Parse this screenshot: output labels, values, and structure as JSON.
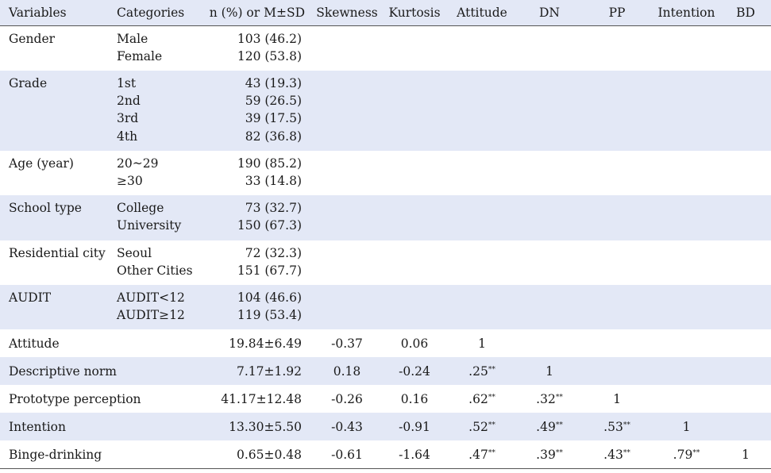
{
  "headers": [
    "Variables",
    "Categories",
    "n (%) or M±SD",
    "Skewness",
    "Kurtosis",
    "Attitude",
    "DN",
    "PP",
    "Intention",
    "BD"
  ],
  "groups": [
    {
      "name": "Gender",
      "categories": [
        "Male",
        "Female"
      ],
      "values": [
        "103 (46.2)",
        "120 (53.8)"
      ]
    },
    {
      "name": "Grade",
      "categories": [
        "1st",
        "2nd",
        "3rd",
        "4th"
      ],
      "values": [
        "43 (19.3)",
        "59 (26.5)",
        "39 (17.5)",
        "82 (36.8)"
      ]
    },
    {
      "name": "Age (year)",
      "categories": [
        "20~29",
        "≥30"
      ],
      "values": [
        "190 (85.2)",
        "33 (14.8)"
      ]
    },
    {
      "name": "School type",
      "categories": [
        "College",
        "University"
      ],
      "values": [
        "73 (32.7)",
        "150 (67.3)"
      ]
    },
    {
      "name": "Residential city",
      "categories": [
        "Seoul",
        "Other Cities"
      ],
      "values": [
        "72 (32.3)",
        "151 (67.7)"
      ]
    },
    {
      "name": "AUDIT",
      "categories": [
        "AUDIT<12",
        "AUDIT≥12"
      ],
      "values": [
        "104 (46.6)",
        "119 (53.4)"
      ]
    }
  ],
  "variables": [
    {
      "name": "Attitude",
      "stat": "19.84±6.49",
      "skewness": "-0.37",
      "kurtosis": "0.06",
      "corr": [
        {
          "v": "1",
          "sig": ""
        },
        {
          "v": "",
          "sig": ""
        },
        {
          "v": "",
          "sig": ""
        },
        {
          "v": "",
          "sig": ""
        },
        {
          "v": "",
          "sig": ""
        }
      ]
    },
    {
      "name": "Descriptive norm",
      "stat": "7.17±1.92",
      "skewness": "0.18",
      "kurtosis": "-0.24",
      "corr": [
        {
          "v": ".25",
          "sig": "**"
        },
        {
          "v": "1",
          "sig": ""
        },
        {
          "v": "",
          "sig": ""
        },
        {
          "v": "",
          "sig": ""
        },
        {
          "v": "",
          "sig": ""
        }
      ]
    },
    {
      "name": "Prototype perception",
      "stat": "41.17±12.48",
      "skewness": "-0.26",
      "kurtosis": "0.16",
      "corr": [
        {
          "v": ".62",
          "sig": "**"
        },
        {
          "v": ".32",
          "sig": "**"
        },
        {
          "v": "1",
          "sig": ""
        },
        {
          "v": "",
          "sig": ""
        },
        {
          "v": "",
          "sig": ""
        }
      ]
    },
    {
      "name": "Intention",
      "stat": "13.30±5.50",
      "skewness": "-0.43",
      "kurtosis": "-0.91",
      "corr": [
        {
          "v": ".52",
          "sig": "**"
        },
        {
          "v": ".49",
          "sig": "**"
        },
        {
          "v": ".53",
          "sig": "**"
        },
        {
          "v": "1",
          "sig": ""
        },
        {
          "v": "",
          "sig": ""
        }
      ]
    },
    {
      "name": "Binge-drinking",
      "stat": "0.65±0.48",
      "skewness": "-0.61",
      "kurtosis": "-1.64",
      "corr": [
        {
          "v": ".47",
          "sig": "**"
        },
        {
          "v": ".39",
          "sig": "**"
        },
        {
          "v": ".43",
          "sig": "**"
        },
        {
          "v": ".79",
          "sig": "**"
        },
        {
          "v": "1",
          "sig": ""
        }
      ]
    }
  ]
}
